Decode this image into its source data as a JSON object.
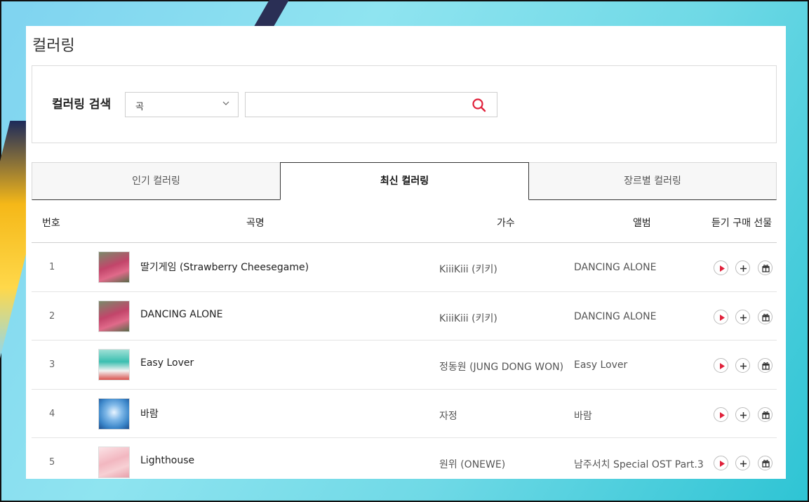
{
  "page": {
    "title": "컬러링"
  },
  "search": {
    "label": "컬러링 검색",
    "select_value": "곡",
    "input_value": "",
    "input_placeholder": ""
  },
  "tabs": [
    {
      "label": "인기 컬러링",
      "active": false
    },
    {
      "label": "최신 컬러링",
      "active": true
    },
    {
      "label": "장르별 컬러링",
      "active": false
    }
  ],
  "table": {
    "headers": {
      "number": "번호",
      "song": "곡명",
      "artist": "가수",
      "album": "앨범",
      "actions": "듣기 구매 선물"
    },
    "rows": [
      {
        "number": "1",
        "song": "딸기게임 (Strawberry Cheesegame)",
        "artist": "KiiiKiii (키키)",
        "album": "DANCING ALONE",
        "thumb_color": "#c2456a"
      },
      {
        "number": "2",
        "song": "DANCING ALONE",
        "artist": "KiiiKiii (키키)",
        "album": "DANCING ALONE",
        "thumb_color": "#c2456a"
      },
      {
        "number": "3",
        "song": "Easy Lover",
        "artist": "정동원 (JUNG DONG WON)",
        "album": "Easy Lover",
        "thumb_color": "#3bbfb0"
      },
      {
        "number": "4",
        "song": "바람",
        "artist": "자정",
        "album": "바람",
        "thumb_color": "#3b86c9"
      },
      {
        "number": "5",
        "song": "Lighthouse",
        "artist": "원위 (ONEWE)",
        "album": "남주서치 Special OST Part.3",
        "thumb_color": "#f2b7c0"
      }
    ]
  },
  "icons": {
    "play": "play-icon",
    "add": "plus-icon",
    "gift": "gift-icon",
    "search": "search-icon",
    "chevron": "chevron-down-icon"
  },
  "colors": {
    "accent": "#e0203a",
    "active_tab_border": "#333333"
  }
}
